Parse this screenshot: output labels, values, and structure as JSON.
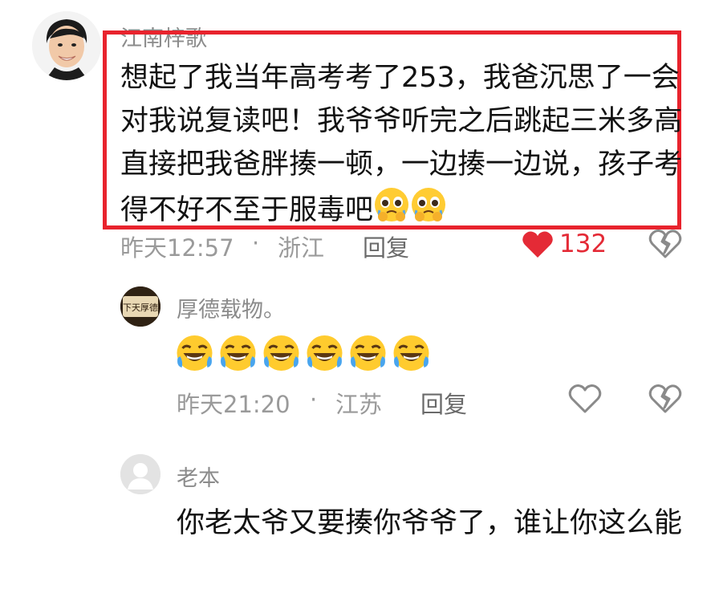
{
  "comments": [
    {
      "user": "江南梓歌",
      "text": "想起了我当年高考考了253，我爸沉思了一会对我说复读吧！我爷爷听完之后跳起三米多高直接把我爸胖揍一顿，一边揍一边说，孩子考得不好不至于服毒吧",
      "emoji_after": "crying-pleading-face",
      "time": "昨天12:57",
      "separator": "·",
      "location": "浙江",
      "reply_label": "回复",
      "like_count": "132",
      "liked": true
    },
    {
      "user": "厚德载物。",
      "emoji_text": "laughing-crying-face x6",
      "time": "昨天21:20",
      "separator": "·",
      "location": "江苏",
      "reply_label": "回复",
      "liked": false
    },
    {
      "user": "老本",
      "text": "你老太爷又要揍你爷爷了，谁让你这么能"
    }
  ],
  "colors": {
    "highlight_border": "#e8232d",
    "like_red": "#e42a36",
    "meta_gray": "#9a9a9a"
  },
  "icons": [
    "heart-filled-icon",
    "heart-broken-icon",
    "heart-outline-icon",
    "default-avatar-icon"
  ]
}
